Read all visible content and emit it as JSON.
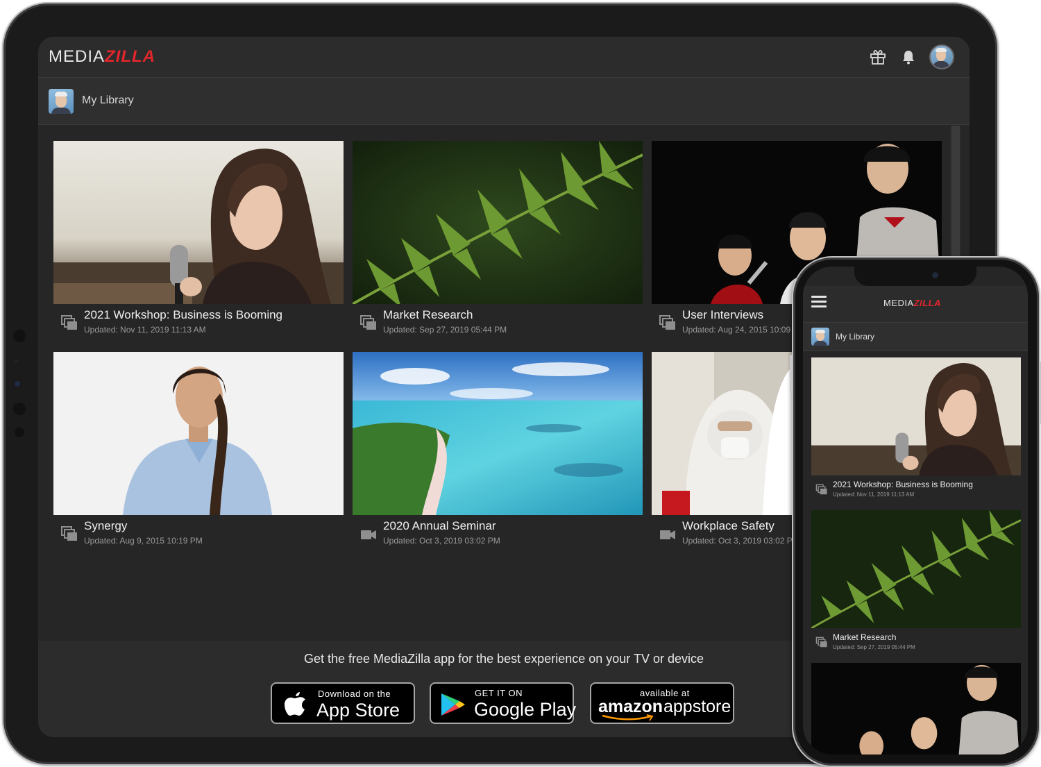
{
  "app": {
    "brand_part1": "MEDIA",
    "brand_part2": "ZILLA",
    "brand_colors": {
      "accent": "#e1262c",
      "background": "#262627",
      "bar": "#2c2c2d"
    }
  },
  "header": {
    "icons": [
      "gift-icon",
      "bell-icon",
      "user-avatar"
    ]
  },
  "library": {
    "title": "My Library"
  },
  "cards": [
    {
      "title": "2021 Workshop: Business is Booming",
      "updated": "Updated: Nov 11, 2019 11:13 AM",
      "type_icon": "stack-icon"
    },
    {
      "title": "Market Research",
      "updated": "Updated: Sep 27, 2019 05:44 PM",
      "type_icon": "stack-icon"
    },
    {
      "title": "User Interviews",
      "updated": "Updated: Aug 24, 2015 10:09",
      "type_icon": "stack-icon"
    },
    {
      "title": "Synergy",
      "updated": "Updated: Aug 9, 2015 10:19 PM",
      "type_icon": "stack-icon"
    },
    {
      "title": "2020 Annual Seminar",
      "updated": "Updated: Oct 3, 2019 03:02 PM",
      "type_icon": "video-camera-icon"
    },
    {
      "title": "Workplace Safety",
      "updated": "Updated: Oct 3, 2019 03:02 P",
      "type_icon": "video-camera-icon"
    }
  ],
  "promo": {
    "text": "Get the free MediaZilla app for the best experience on your TV or device",
    "app_store": {
      "small": "Download on the",
      "large": "App Store"
    },
    "google_play": {
      "small": "GET IT ON",
      "large": "Google Play"
    },
    "amazon": {
      "small": "available at",
      "large_1": "amazon",
      "large_2": "appstore"
    }
  },
  "phone": {
    "library_title": "My Library",
    "cards": [
      {
        "title": "2021 Workshop: Business is Booming",
        "updated": "Updated: Nov 11, 2019 11:13 AM"
      },
      {
        "title": "Market Research",
        "updated": "Updated: Sep 27, 2019 05:44 PM"
      }
    ]
  }
}
